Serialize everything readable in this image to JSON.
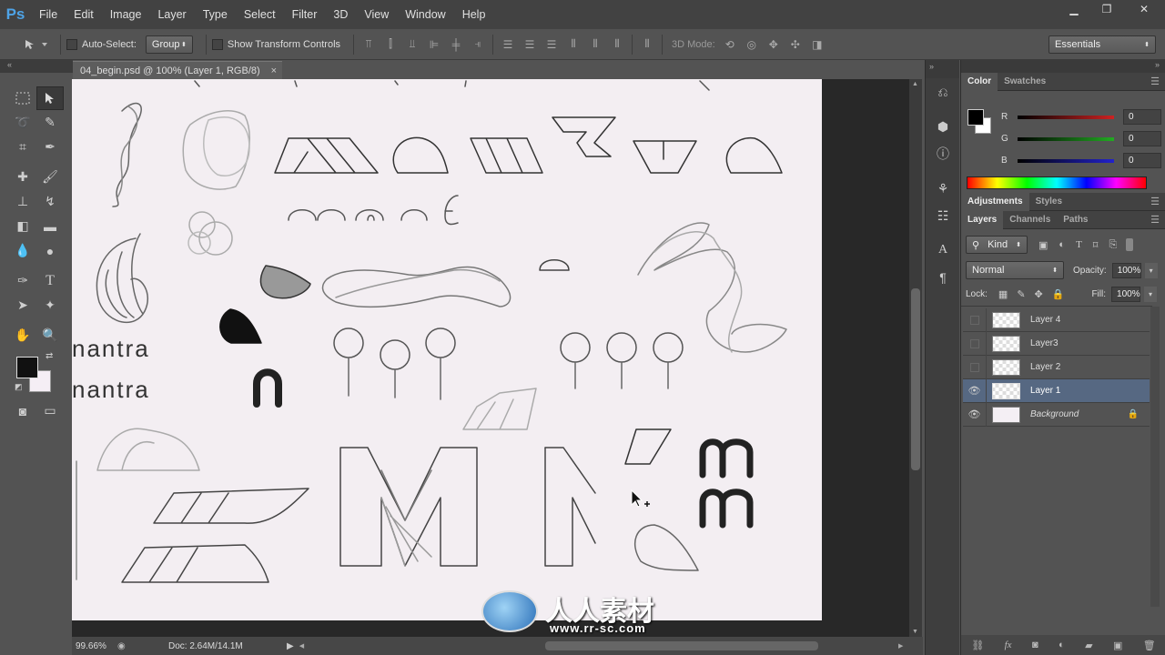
{
  "app": {
    "logo": "Ps"
  },
  "menu": [
    "File",
    "Edit",
    "Image",
    "Layer",
    "Type",
    "Select",
    "Filter",
    "3D",
    "View",
    "Window",
    "Help"
  ],
  "window_controls": {
    "minimize": "▁",
    "restore": "❐",
    "close": "✕"
  },
  "options": {
    "auto_select_label": "Auto-Select:",
    "auto_select_value": "Group",
    "transform_label": "Show Transform Controls",
    "mode_3d_label": "3D Mode:",
    "workspace": "Essentials"
  },
  "document": {
    "tab_title": "04_begin.psd @ 100% (Layer 1, RGB/8)",
    "close": "×",
    "zoom": "99.66%",
    "doc_info": "Doc: 2.64M/14.1M"
  },
  "color_panel": {
    "tabs": [
      "Color",
      "Swatches"
    ],
    "channels": [
      {
        "label": "R",
        "value": "0",
        "color": "#c22"
      },
      {
        "label": "G",
        "value": "0",
        "color": "#2a2"
      },
      {
        "label": "B",
        "value": "0",
        "color": "#22c"
      }
    ]
  },
  "adjust_tabs": [
    "Adjustments",
    "Styles"
  ],
  "layers_panel": {
    "tabs": [
      "Layers",
      "Channels",
      "Paths"
    ],
    "filter_kind": "Kind",
    "blend_mode": "Normal",
    "opacity_label": "Opacity:",
    "opacity": "100%",
    "lock_label": "Lock:",
    "fill_label": "Fill:",
    "fill": "100%",
    "layers": [
      {
        "name": "Layer 4",
        "visible": false,
        "selected": false
      },
      {
        "name": "Layer3",
        "visible": false,
        "selected": false
      },
      {
        "name": "Layer 2",
        "visible": false,
        "selected": false
      },
      {
        "name": "Layer 1",
        "visible": true,
        "selected": true
      },
      {
        "name": "Background",
        "visible": true,
        "selected": false
      }
    ]
  },
  "sketch_text": {
    "line1": "nantra",
    "line2": "nantra"
  },
  "watermark": {
    "brand": "人人素材",
    "url": "www.rr-sc.com"
  },
  "colors": {
    "accent": "#4ea3e6",
    "selected_layer": "#566882"
  }
}
